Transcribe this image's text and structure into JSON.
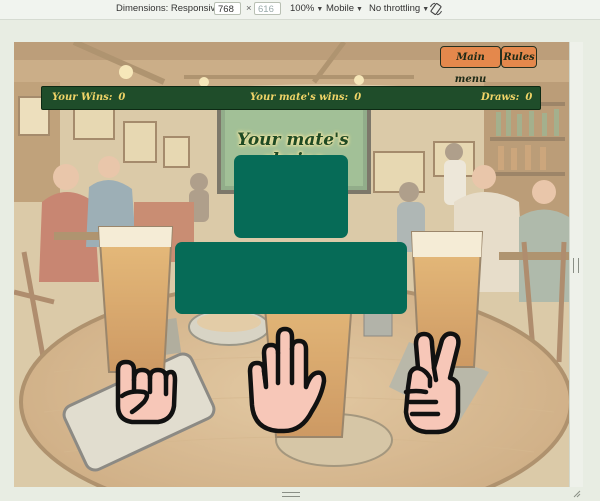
{
  "devtools": {
    "dimensions_label": "Dimensions: Responsive",
    "width_value": "768",
    "height_value": "616",
    "times_sign": "×",
    "zoom": "100%",
    "device": "Mobile",
    "throttling": "No throttling",
    "rotate_icon": "rotate-icon"
  },
  "game": {
    "main_menu_label": "Main menu",
    "rules_label": "Rules",
    "scores": {
      "your_wins_label": "Your Wins:",
      "your_wins_value": "0",
      "mate_wins_label": "Your mate's wins:",
      "mate_wins_value": "0",
      "draws_label": "Draws:",
      "draws_value": "0"
    },
    "mate_choice_heading": "Your mate's choice",
    "choices": [
      {
        "name": "rock",
        "icon": "fist-icon"
      },
      {
        "name": "paper",
        "icon": "open-hand-icon"
      },
      {
        "name": "scissors",
        "icon": "victory-hand-icon"
      }
    ],
    "colors": {
      "button": "#e4884c",
      "scorebar": "#1f4d2a",
      "score_text": "#f0d468",
      "panel": "#066b57",
      "skin": "#f7c7b8"
    }
  }
}
